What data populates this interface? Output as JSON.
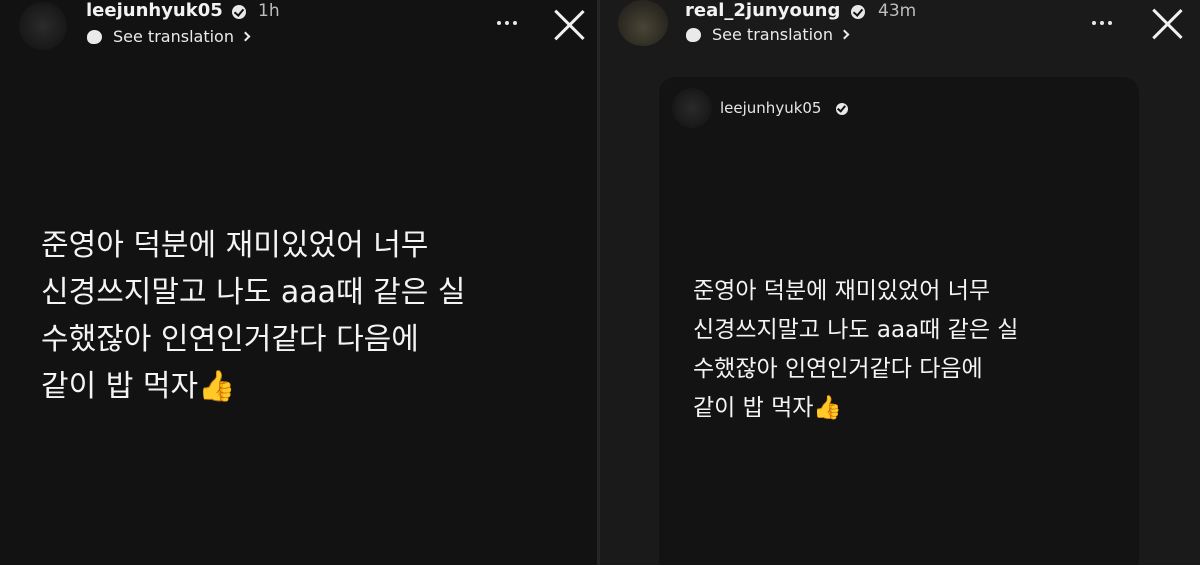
{
  "left_story": {
    "username": "leejunhyuk05",
    "time": "1h",
    "see_translation": "See translation",
    "message": "준영아 덕분에 재미있었어 너무\n신경쓰지말고 나도 aaa때 같은 실\n수했잖아 인연인거같다 다음에\n같이 밥 먹자👍"
  },
  "right_story": {
    "username": "real_2junyoung",
    "time": "43m",
    "see_translation": "See translation",
    "shared_post": {
      "username": "leejunhyuk05",
      "message": "준영아 덕분에 재미있었어 너무\n신경쓰지말고 나도 aaa때 같은 실\n수했잖아 인연인거같다 다음에\n같이 밥 먹자👍"
    }
  }
}
